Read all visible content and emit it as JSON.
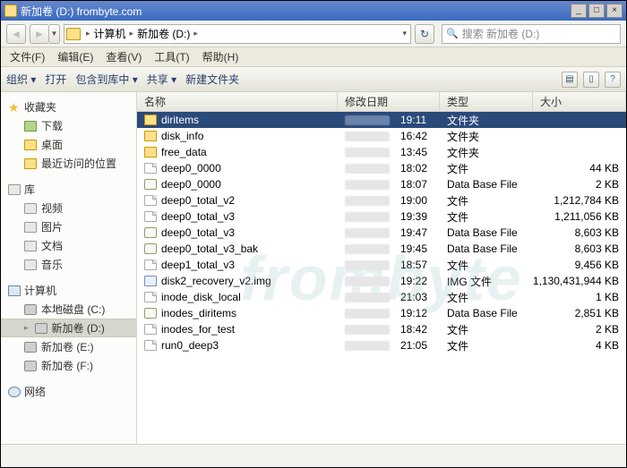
{
  "window": {
    "title": "新加卷 (D:) frombyte.com",
    "controls": {
      "min": "_",
      "max": "□",
      "close": "×"
    }
  },
  "breadcrumb": {
    "computer": "计算机",
    "drive": "新加卷 (D:)"
  },
  "search": {
    "placeholder": "搜索 新加卷 (D:)"
  },
  "menu": {
    "file": "文件(F)",
    "edit": "编辑(E)",
    "view": "查看(V)",
    "tools": "工具(T)",
    "help": "帮助(H)"
  },
  "toolbar": {
    "organize": "组织 ▾",
    "open": "打开",
    "include": "包含到库中 ▾",
    "share": "共享 ▾",
    "newfolder": "新建文件夹"
  },
  "sidebar": {
    "favorites": {
      "header": "收藏夹",
      "items": [
        "下载",
        "桌面",
        "最近访问的位置"
      ]
    },
    "libraries": {
      "header": "库",
      "items": [
        "视频",
        "图片",
        "文档",
        "音乐"
      ]
    },
    "computer": {
      "header": "计算机",
      "items": [
        "本地磁盘 (C:)",
        "新加卷 (D:)",
        "新加卷 (E:)",
        "新加卷 (F:)"
      ],
      "selectedIndex": 1
    },
    "network": {
      "header": "网络"
    }
  },
  "columns": {
    "name": "名称",
    "date": "修改日期",
    "type": "类型",
    "size": "大小"
  },
  "files": [
    {
      "name": "diritems",
      "kind": "folder",
      "time": "19:11",
      "type": "文件夹",
      "size": "",
      "selected": true
    },
    {
      "name": "disk_info",
      "kind": "folder",
      "time": "16:42",
      "type": "文件夹",
      "size": ""
    },
    {
      "name": "free_data",
      "kind": "folder",
      "time": "13:45",
      "type": "文件夹",
      "size": ""
    },
    {
      "name": "deep0_0000",
      "kind": "file",
      "time": "18:02",
      "type": "文件",
      "size": "44 KB"
    },
    {
      "name": "deep0_0000",
      "kind": "db",
      "time": "18:07",
      "type": "Data Base File",
      "size": "2 KB"
    },
    {
      "name": "deep0_total_v2",
      "kind": "file",
      "time": "19:00",
      "type": "文件",
      "size": "1,212,784 KB"
    },
    {
      "name": "deep0_total_v3",
      "kind": "file",
      "time": "19:39",
      "type": "文件",
      "size": "1,211,056 KB"
    },
    {
      "name": "deep0_total_v3",
      "kind": "db",
      "time": "19:47",
      "type": "Data Base File",
      "size": "8,603 KB"
    },
    {
      "name": "deep0_total_v3_bak",
      "kind": "db",
      "time": "19:45",
      "type": "Data Base File",
      "size": "8,603 KB"
    },
    {
      "name": "deep1_total_v3",
      "kind": "file",
      "time": "18:57",
      "type": "文件",
      "size": "9,456 KB"
    },
    {
      "name": "disk2_recovery_v2.img",
      "kind": "img",
      "time": "19:22",
      "type": "IMG 文件",
      "size": "1,130,431,944 KB"
    },
    {
      "name": "inode_disk_local",
      "kind": "file",
      "time": "21:03",
      "type": "文件",
      "size": "1 KB"
    },
    {
      "name": "inodes_diritems",
      "kind": "db",
      "time": "19:12",
      "type": "Data Base File",
      "size": "2,851 KB"
    },
    {
      "name": "inodes_for_test",
      "kind": "file",
      "time": "18:42",
      "type": "文件",
      "size": "2 KB"
    },
    {
      "name": "run0_deep3",
      "kind": "file",
      "time": "21:05",
      "type": "文件",
      "size": "4 KB"
    }
  ],
  "watermark": "frombyte"
}
